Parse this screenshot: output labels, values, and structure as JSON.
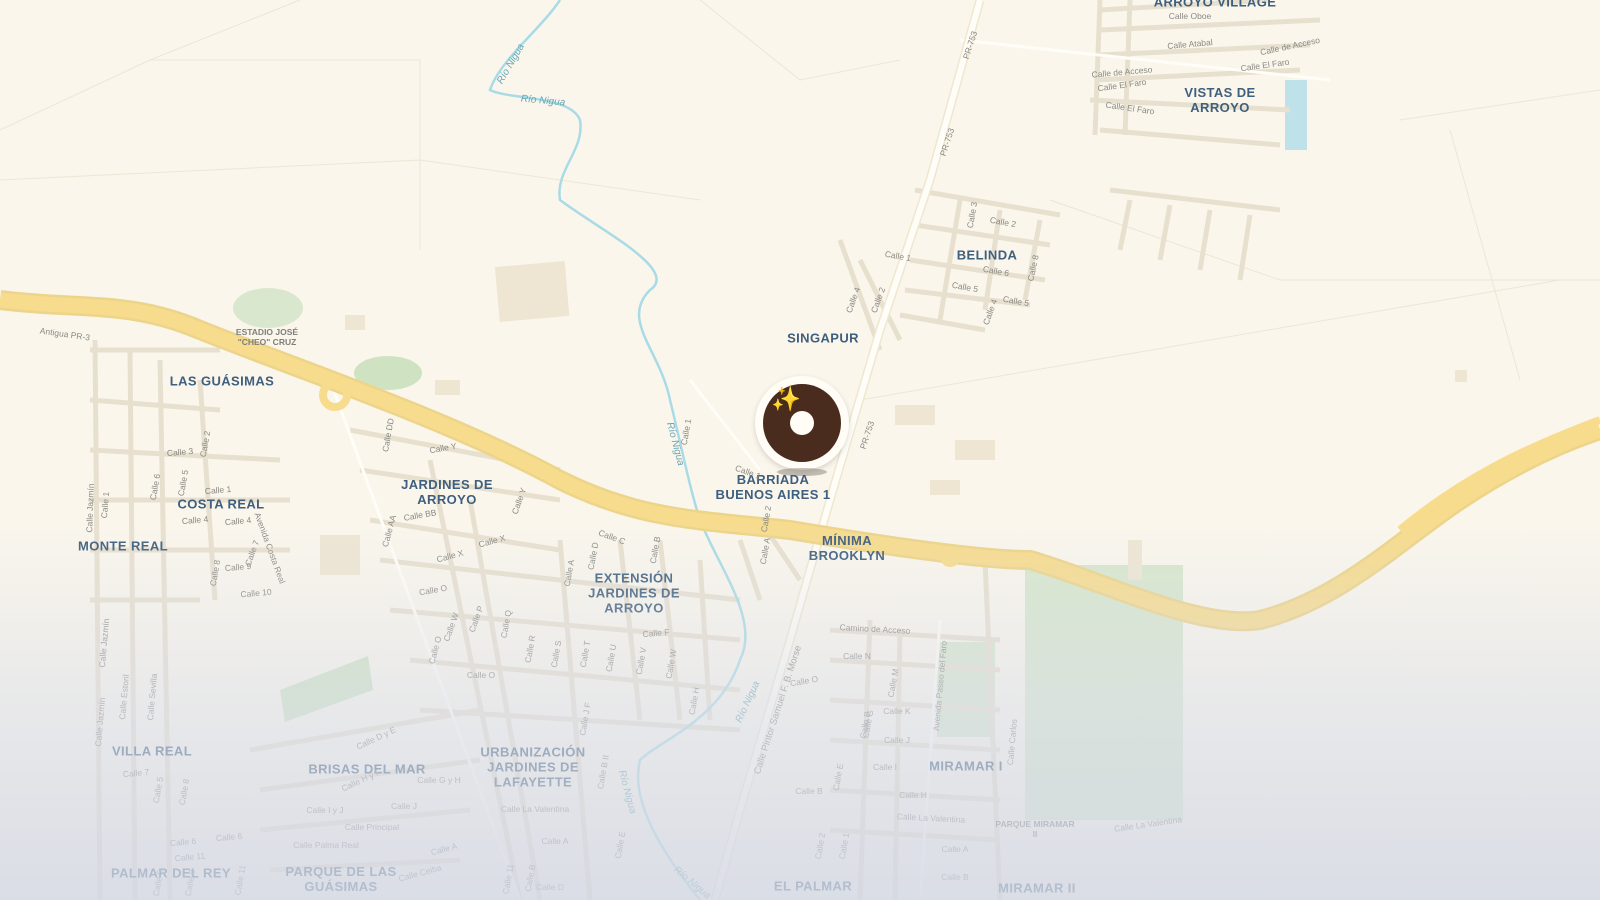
{
  "map": {
    "neighborhoods": [
      {
        "id": "arroyo-village",
        "text": "ARROYO VILLAGE"
      },
      {
        "id": "vistas-de-arroyo",
        "text": "VISTAS DE\nARROYO"
      },
      {
        "id": "belinda",
        "text": "BELINDA"
      },
      {
        "id": "singapur",
        "text": "SINGAPUR"
      },
      {
        "id": "las-guasimas",
        "text": "LAS GUÁSIMAS"
      },
      {
        "id": "barriada-buenos-aires",
        "text": "BARRIADA\nBUENOS AIRES 1"
      },
      {
        "id": "jardines-de-arroyo",
        "text": "JARDINES DE\nARROYO"
      },
      {
        "id": "costa-real",
        "text": "COSTA REAL"
      },
      {
        "id": "monte-real",
        "text": "MONTE REAL"
      },
      {
        "id": "minima-brooklyn",
        "text": "MÍNIMA\nBROOKLYN"
      },
      {
        "id": "extension-jardines",
        "text": "EXTENSIÓN\nJARDINES DE\nARROYO"
      },
      {
        "id": "villa-real",
        "text": "VILLA REAL"
      },
      {
        "id": "brisas-del-mar",
        "text": "BRISAS DEL MAR"
      },
      {
        "id": "urbanizacion-lafayette",
        "text": "URBANIZACIÓN\nJARDINES DE\nLAFAYETTE"
      },
      {
        "id": "miramar-i",
        "text": "MIRAMAR I"
      },
      {
        "id": "palmar-del-rey",
        "text": "PALMAR DEL REY"
      },
      {
        "id": "parque-de-las-guasimas",
        "text": "PARQUE DE LAS\nGUÁSIMAS"
      },
      {
        "id": "el-palmar",
        "text": "EL PALMAR"
      },
      {
        "id": "miramar-ii",
        "text": "MIRAMAR II"
      }
    ],
    "pois": [
      {
        "id": "estadio",
        "text": "ESTADIO JOSÉ\n\"CHEO\" CRUZ"
      },
      {
        "id": "parque-miramar",
        "text": "PARQUE MIRAMAR\nII"
      }
    ],
    "water_labels": [
      {
        "id": "rio-nigua-1",
        "text": "Río Nigua"
      },
      {
        "id": "rio-nigua-2",
        "text": "Río Nigua"
      },
      {
        "id": "rio-nigua-3",
        "text": "Río Nigua"
      },
      {
        "id": "rio-nigua-4",
        "text": "Río Nigua"
      },
      {
        "id": "rio-nigua-5",
        "text": "Río Nigua"
      },
      {
        "id": "rio-nigua-6",
        "text": "Río Nigua"
      }
    ],
    "roads": [
      {
        "id": "pr753-a",
        "text": "PR-753"
      },
      {
        "id": "pr753-b",
        "text": "PR-753"
      },
      {
        "id": "pr753-c",
        "text": "PR-753"
      },
      {
        "id": "antigua",
        "text": "Antigua PR-3"
      },
      {
        "id": "pintor",
        "text": "Calle Pintor Samuel F. B. Morse"
      },
      {
        "id": "camino-acceso",
        "text": "Camino de Acceso"
      },
      {
        "id": "paseo-faro",
        "text": "Avenida Paseo del Faro"
      },
      {
        "id": "la-valentina-1",
        "text": "Calle La Valentina"
      },
      {
        "id": "la-valentina-2",
        "text": "Calle La Valentina"
      },
      {
        "id": "la-valentina-3",
        "text": "Calle La Valentina"
      }
    ],
    "streets": [
      "Calle Oboe",
      "Calle Atabal",
      "Calle de Acceso",
      "Calle El Faro",
      "Calle de Acceso",
      "Calle El Faro",
      "Calle El Faro",
      "Calle 2",
      "Calle 1",
      "Calle 6",
      "Calle 5",
      "Calle 5",
      "Calle 3",
      "Calle 8",
      "Calle 4",
      "Calle 2",
      "Calle 4",
      "Calle 3",
      "Calle 2",
      "Calle 1",
      "Calle 6",
      "Calle 5",
      "Calle 4",
      "Calle 4",
      "Calle 7",
      "Calle 9",
      "Calle 8",
      "Calle 10",
      "Calle 1",
      "Calle Jazmín",
      "Avenida Costa Real",
      "Calle DD",
      "Calle Y",
      "Calle BB",
      "Calle AA",
      "Calle X",
      "Calle X",
      "Calle Y",
      "Calle O",
      "Calle C",
      "Calle D",
      "Calle A",
      "Calle B",
      "Calle P",
      "Calle Q",
      "Calle W",
      "Calle R",
      "Calle S",
      "Calle T",
      "Calle U",
      "Calle V",
      "Calle W",
      "Calle F",
      "Calle O",
      "Calle O",
      "Calle H",
      "Calle 1",
      "Calle 1",
      "Calle 2",
      "Calle A",
      "Calle N",
      "Calle M",
      "Calle O",
      "Calle K",
      "Calle J",
      "Calle I",
      "Calle H",
      "Calle G",
      "Calle E",
      "Calle B",
      "Calle Jazmín",
      "Calle Estoril",
      "Calle Sevilla",
      "Calle 7",
      "Calle 5",
      "Calle 8",
      "Calle D y E",
      "Calle H y F",
      "Calle G y H",
      "Calle I y J",
      "Calle J",
      "Calle Principal",
      "Calle Palma Real",
      "Calle 6",
      "Calle 11",
      "Calle 6",
      "Calle 11",
      "Calle A",
      "Calle Ceiba",
      "Calle J F",
      "Calle B II",
      "Calle A",
      "Calle D",
      "Calle E",
      "Calle B",
      "Calle 2",
      "Calle 1",
      "Calle A",
      "Calle B",
      "Calle Carlos",
      "Calle Jazmín",
      "Calle 5",
      "Calle 8",
      "Calle 11",
      "Calle B",
      "Calle G"
    ],
    "marker": {
      "name": "selected-location-marker",
      "icon": "sparkles-icon",
      "glyph": "✨"
    },
    "colors": {
      "land": "#faf6ec",
      "highway": "#f6dc8e",
      "water": "#a9dbe6",
      "label": "#3f5f7e",
      "park": "#cfe3c2",
      "marker": "#4a2c1e"
    }
  }
}
